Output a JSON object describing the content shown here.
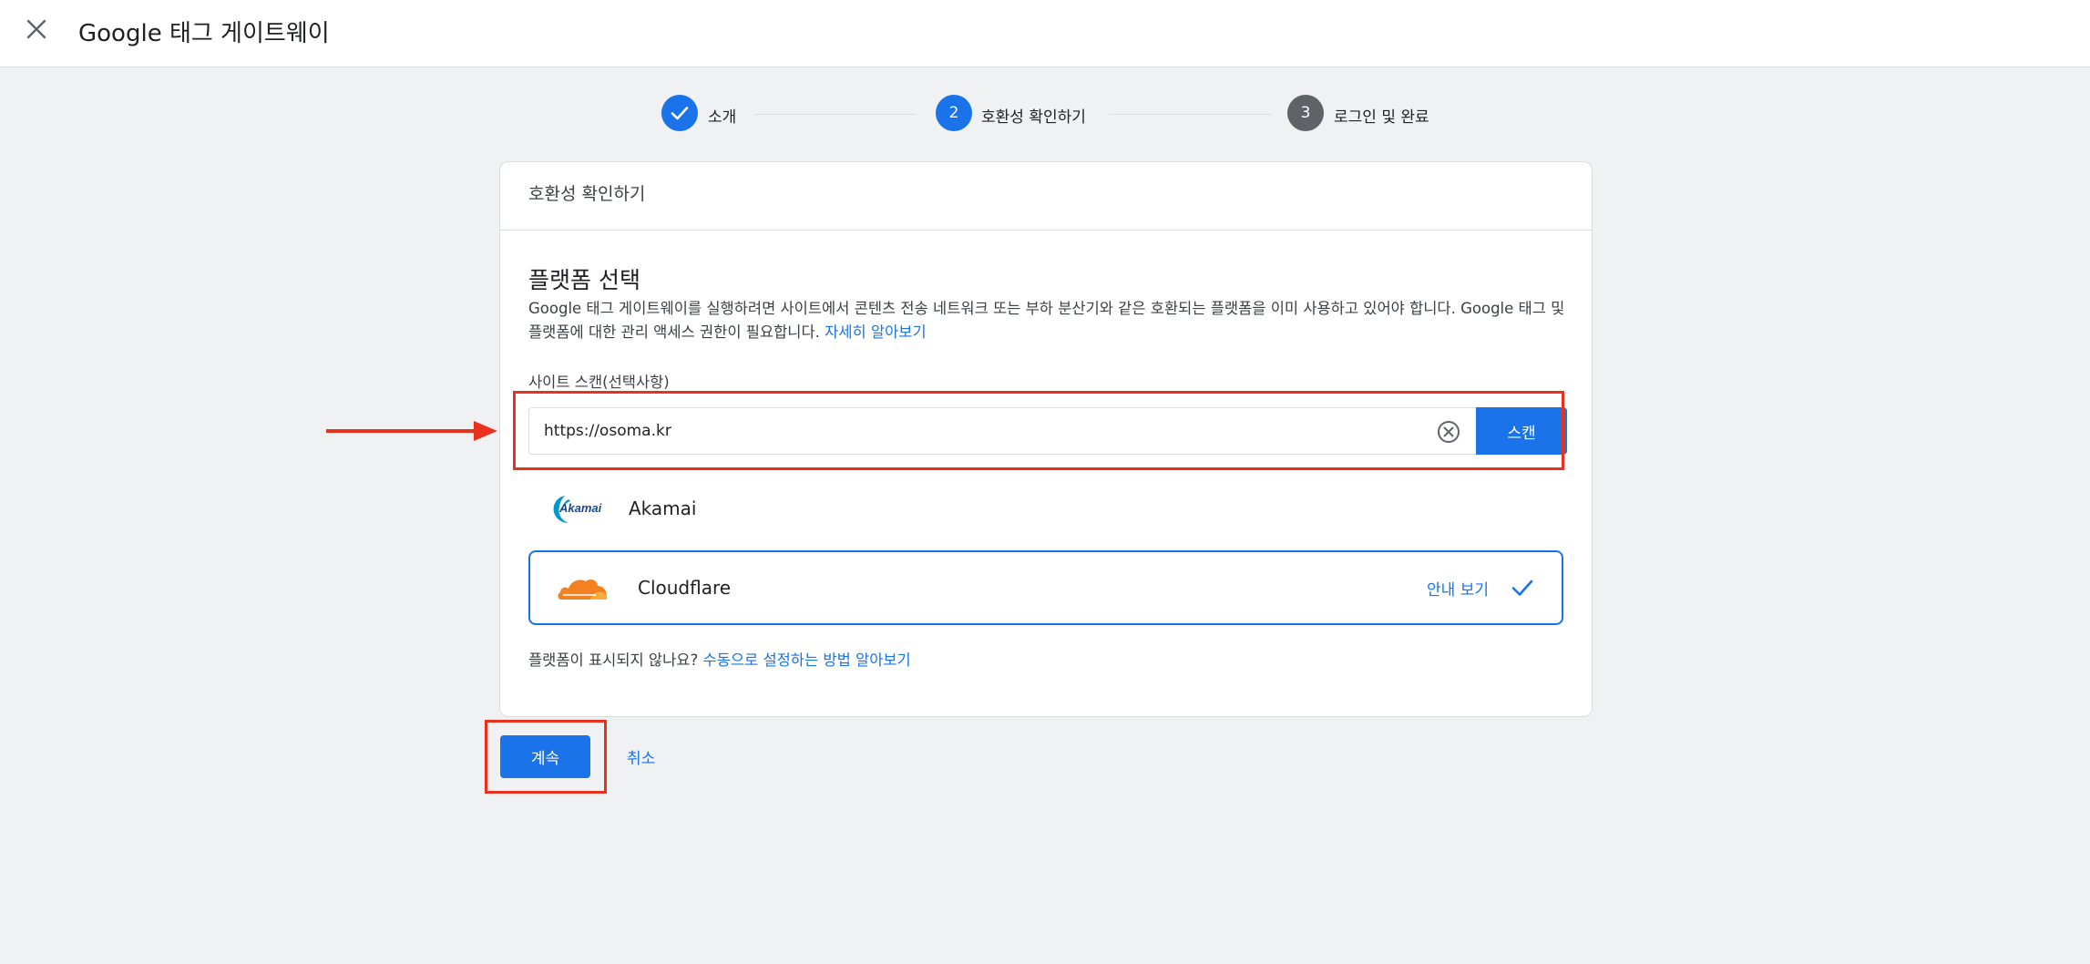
{
  "header": {
    "title": "Google 태그 게이트웨이",
    "close_icon": "close-icon"
  },
  "stepper": {
    "steps": [
      {
        "number": "✓",
        "label": "소개",
        "status": "done"
      },
      {
        "number": "2",
        "label": "호환성 확인하기",
        "status": "active"
      },
      {
        "number": "3",
        "label": "로그인 및 완료",
        "status": "pending"
      }
    ]
  },
  "card": {
    "header": "호환성 확인하기",
    "section_title": "플랫폼 선택",
    "description": "Google 태그 게이트웨이를 실행하려면 사이트에서 콘텐츠 전송 네트워크 또는 부하 분산기와 같은 호환되는 플랫폼을 이미 사용하고 있어야 합니다. Google 태그 및 플랫폼에 대한 관리 액세스 권한이 필요합니다.",
    "learn_more": "자세히 알아보기",
    "scan": {
      "label": "사이트 스캔(선택사항)",
      "value": "https://osoma.kr",
      "button": "스캔"
    },
    "platforms": [
      {
        "name": "Akamai",
        "logo_text": "Akamai",
        "selected": false
      },
      {
        "name": "Cloudflare",
        "guide": "안내 보기",
        "selected": true
      }
    ],
    "footer": {
      "text": "플랫폼이 표시되지 않나요?",
      "link": "수동으로 설정하는 방법 알아보기"
    }
  },
  "actions": {
    "continue": "계속",
    "cancel": "취소"
  },
  "colors": {
    "accent": "#1a73e8",
    "highlight": "#e8321e",
    "background": "#f0f1f3",
    "step_pending": "#5f6368"
  }
}
